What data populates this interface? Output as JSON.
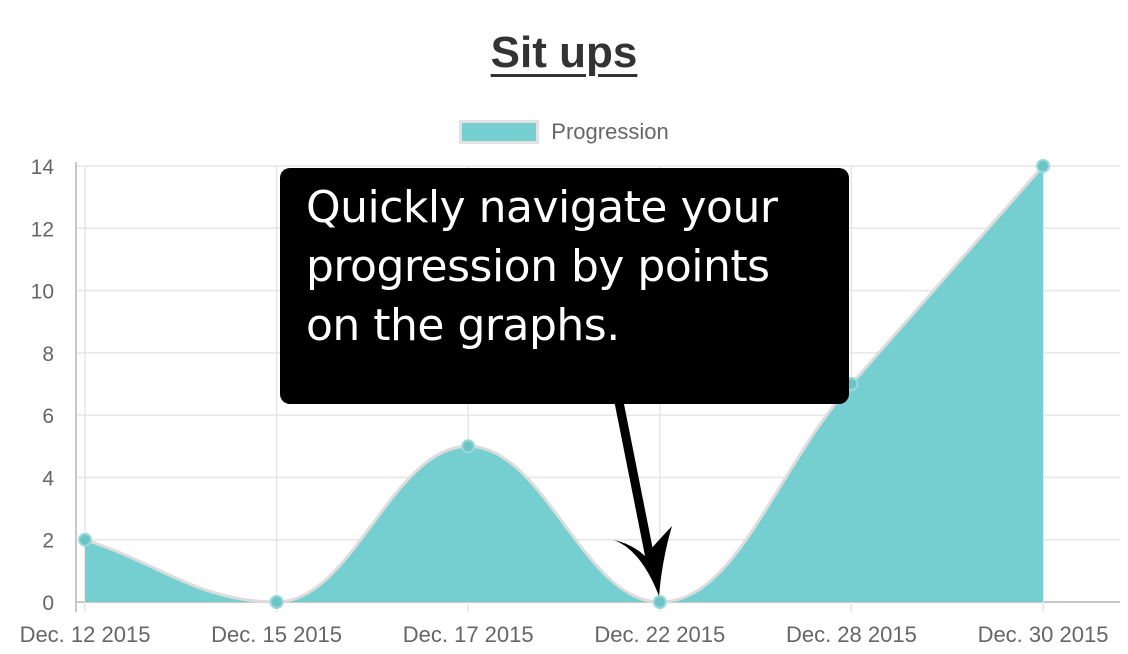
{
  "chart_data": {
    "type": "area",
    "title": "Sit ups",
    "legend": {
      "position": "top",
      "entries": [
        "Progression"
      ]
    },
    "categories": [
      "Dec. 12 2015",
      "Dec. 15 2015",
      "Dec. 17 2015",
      "Dec. 22 2015",
      "Dec. 28 2015",
      "Dec. 30 2015"
    ],
    "series": [
      {
        "name": "Progression",
        "values": [
          2,
          0,
          5,
          0,
          7,
          14
        ],
        "color": "#75cfd1",
        "line_color": "#dcdcdc"
      }
    ],
    "ylim": [
      0,
      14
    ],
    "y_ticks": [
      0,
      2,
      4,
      6,
      8,
      10,
      12,
      14
    ],
    "grid": true,
    "xlabel": "",
    "ylabel": ""
  },
  "annotation": {
    "text": "Quickly navigate your progression by points on the graphs."
  }
}
